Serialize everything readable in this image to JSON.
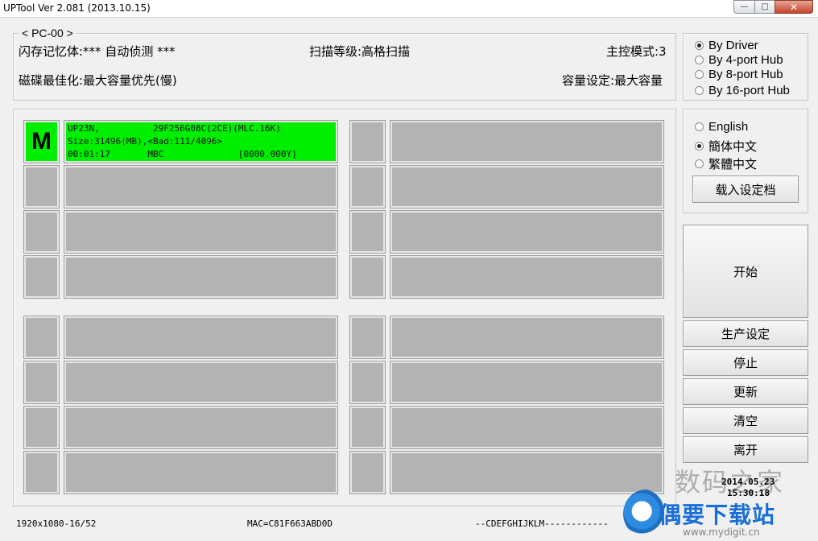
{
  "window": {
    "title": "UPTool Ver 2.081 (2013.10.15)",
    "min_glyph": "—",
    "max_glyph": "□",
    "close_glyph": "✕"
  },
  "info": {
    "group_label": "< PC-00 >",
    "flash_memory": "闪存记忆体:*** 自动侦测 ***",
    "scan_level": "扫描等级:高格扫描",
    "master_mode": "主控模式:3",
    "disk_optimize": "磁碟最佳化:最大容量优先(慢)",
    "capacity_setting": "容量设定:最大容量"
  },
  "hub_mode": {
    "options": [
      "By Driver",
      "By 4-port Hub",
      "By 8-port Hub",
      "By 16-port Hub"
    ],
    "selected": 0
  },
  "language": {
    "options": [
      "English",
      "簡体中文",
      "繁體中文"
    ],
    "selected": 1,
    "load_button": "载入设定档"
  },
  "buttons": {
    "start": "开始",
    "production_settings": "生产设定",
    "stop": "停止",
    "update": "更新",
    "clear": "清空",
    "leave": "离开"
  },
  "device_slot": {
    "letter": "M",
    "line1": "UP23N,          29F256G08C(2CE)(MLC.16K)",
    "line2": "Size:31496(MB),<Bad:111/4096>",
    "line3": "00:01:17       MBC              [0000.000Y]",
    "active_color": "#00ee00",
    "idle_color": "#b3b3b3"
  },
  "status_bar": {
    "resolution": "1920x1080-16/52",
    "mac": "MAC=C81F663ABD0D",
    "drives": "--CDEFGHIJKLM------------"
  },
  "watermark": {
    "site_cn": "数码之家",
    "site_cn2": "偶要下载站",
    "url": "www.mydigit.cn",
    "date": "2014.05.23",
    "time": "15:30:18"
  }
}
